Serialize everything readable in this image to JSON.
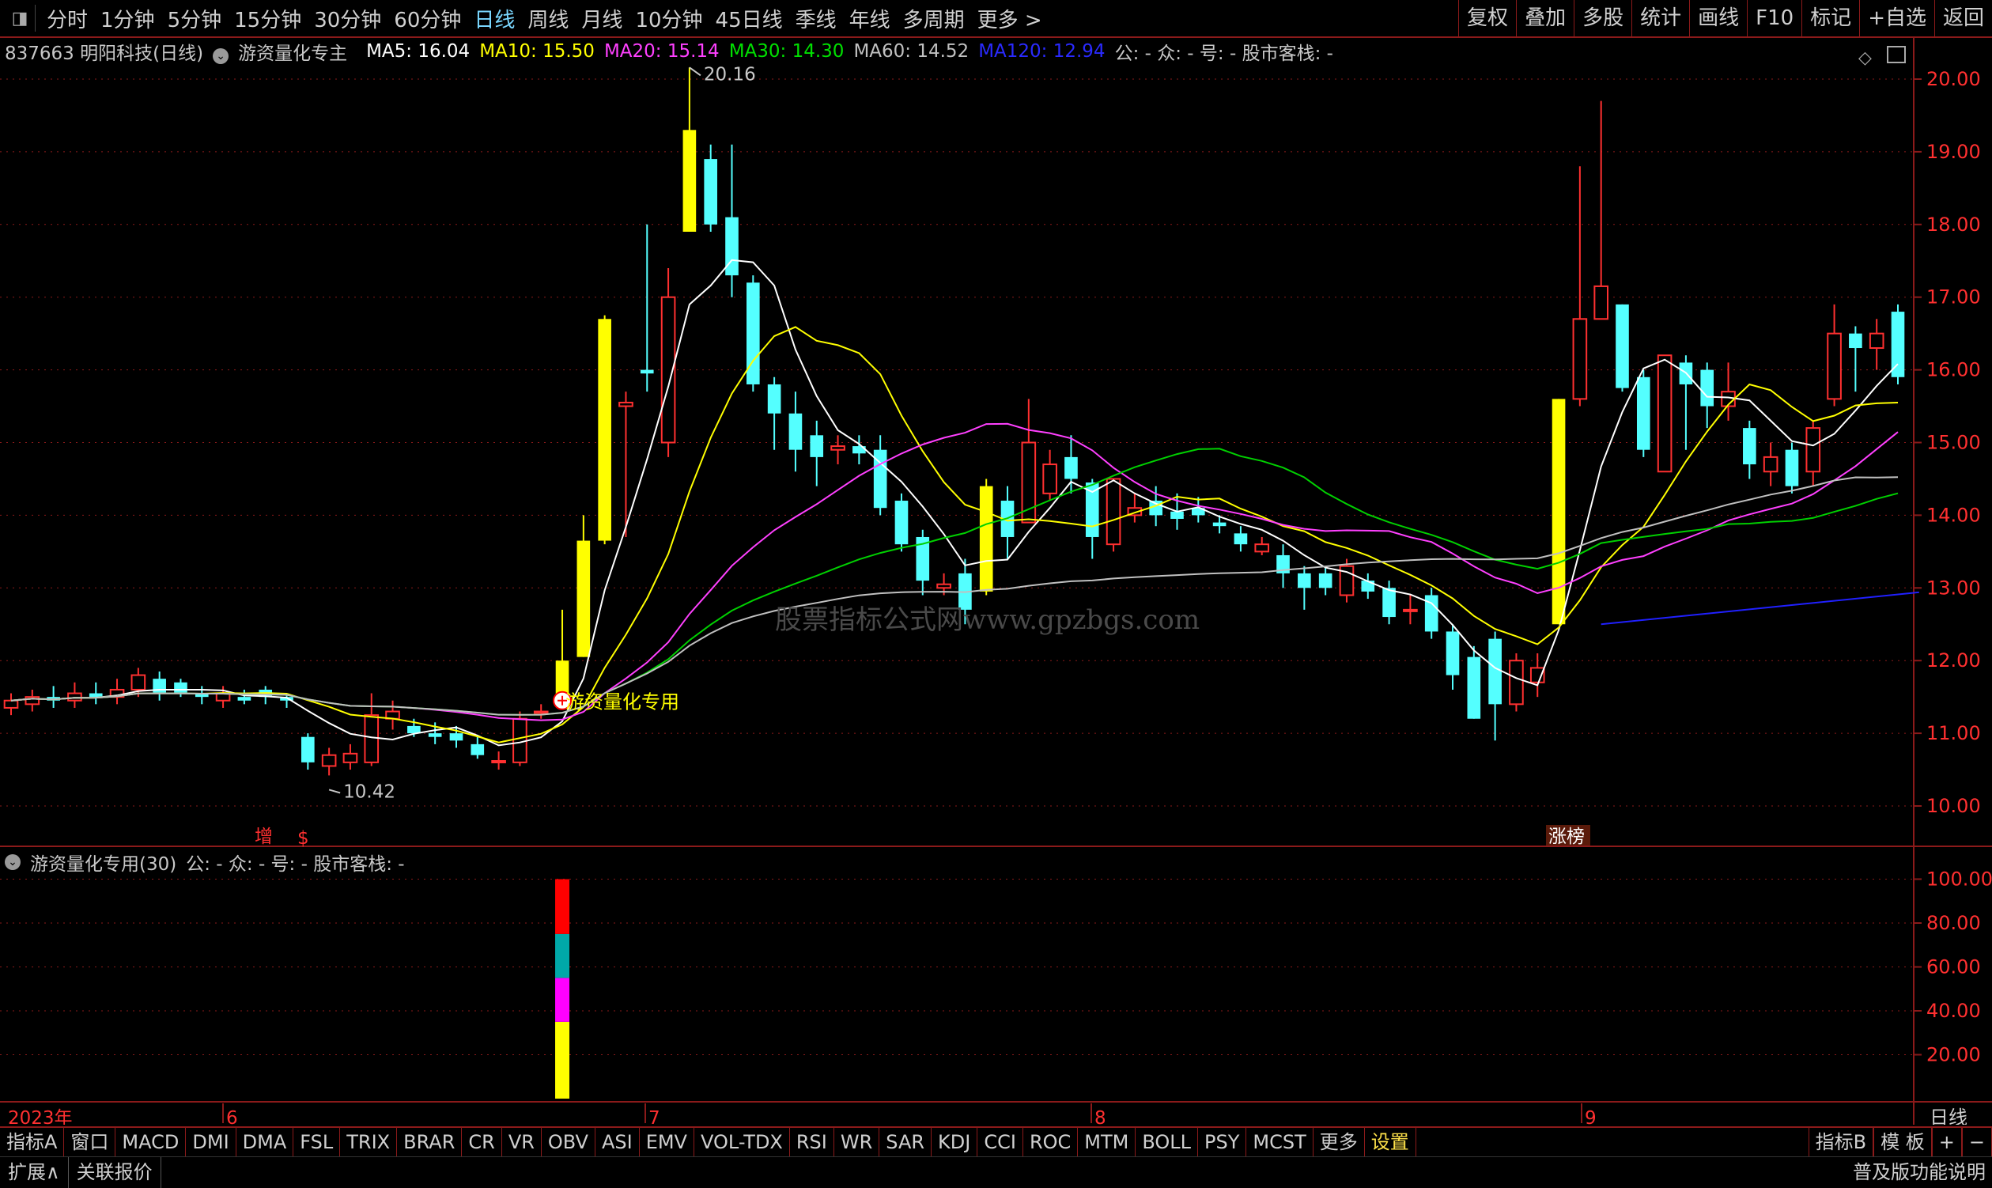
{
  "top_menu": {
    "menu_icon": "window-icon",
    "periods": [
      "分时",
      "1分钟",
      "5分钟",
      "15分钟",
      "30分钟",
      "60分钟",
      "日线",
      "周线",
      "月线",
      "10分钟",
      "45日线",
      "季线",
      "年线",
      "多周期",
      "更多 >"
    ],
    "active_period": "日线",
    "right_buttons": [
      "复权",
      "叠加",
      "多股",
      "统计",
      "画线",
      "F10",
      "标记",
      "+自选",
      "返回"
    ]
  },
  "info": {
    "stock": "837663 明阳科技(日线)",
    "indicator": "游资量化专主",
    "ma5": "MA5: 16.04",
    "ma10": "MA10: 15.50",
    "ma20": "MA20: 15.14",
    "ma30": "MA30: 14.30",
    "ma60": "MA60: 14.52",
    "ma120": "MA120: 12.94",
    "extra": "公: -  众: -  号: -  股市客栈: -"
  },
  "sub": {
    "title": "游资量化专用(30)",
    "extra": "公: -  众: -  号: -  股市客栈: -"
  },
  "labels": {
    "high": "20.16",
    "low": "10.42",
    "signal": "游资量化专用",
    "zeng": "增",
    "dollar": "$",
    "zhangbang": "涨榜",
    "watermark": "股票指标公式网www.gpzbgs.com",
    "year": "2023年",
    "months": [
      "6",
      "7",
      "8",
      "9"
    ],
    "period_label": "日线"
  },
  "colors": {
    "up": "#ff3030",
    "down": "#54ffff",
    "ma5": "#ffffff",
    "ma10": "#ffff00",
    "ma20": "#ff40ff",
    "ma30": "#00d000",
    "ma60": "#c0c0c0",
    "ma120": "#2020ff",
    "grid": "#8b1a1a",
    "signal": "#ffff00"
  },
  "chart_data": {
    "type": "candlestick",
    "yticks": [
      10,
      11,
      12,
      13,
      14,
      15,
      16,
      17,
      18,
      19,
      20
    ],
    "sub_yticks": [
      20,
      40,
      60,
      80,
      100
    ],
    "candles": [
      {
        "o": 11.35,
        "c": 11.45,
        "h": 11.55,
        "l": 11.25
      },
      {
        "o": 11.4,
        "c": 11.5,
        "h": 11.6,
        "l": 11.3
      },
      {
        "o": 11.5,
        "c": 11.45,
        "h": 11.65,
        "l": 11.35
      },
      {
        "o": 11.45,
        "c": 11.55,
        "h": 11.7,
        "l": 11.35
      },
      {
        "o": 11.55,
        "c": 11.5,
        "h": 11.7,
        "l": 11.4
      },
      {
        "o": 11.5,
        "c": 11.6,
        "h": 11.75,
        "l": 11.4
      },
      {
        "o": 11.6,
        "c": 11.8,
        "h": 11.9,
        "l": 11.5
      },
      {
        "o": 11.75,
        "c": 11.55,
        "h": 11.85,
        "l": 11.45
      },
      {
        "o": 11.7,
        "c": 11.55,
        "h": 11.75,
        "l": 11.5
      },
      {
        "o": 11.55,
        "c": 11.5,
        "h": 11.65,
        "l": 11.4
      },
      {
        "o": 11.45,
        "c": 11.55,
        "h": 11.65,
        "l": 11.35
      },
      {
        "o": 11.5,
        "c": 11.45,
        "h": 11.6,
        "l": 11.4
      },
      {
        "o": 11.6,
        "c": 11.5,
        "h": 11.65,
        "l": 11.4
      },
      {
        "o": 11.5,
        "c": 11.45,
        "h": 11.55,
        "l": 11.35
      },
      {
        "o": 10.95,
        "c": 10.6,
        "h": 11.0,
        "l": 10.5
      },
      {
        "o": 10.55,
        "c": 10.7,
        "h": 10.8,
        "l": 10.42
      },
      {
        "o": 10.6,
        "c": 10.72,
        "h": 10.85,
        "l": 10.5
      },
      {
        "o": 10.6,
        "c": 11.25,
        "h": 11.55,
        "l": 10.55
      },
      {
        "o": 11.2,
        "c": 11.3,
        "h": 11.45,
        "l": 11.05
      },
      {
        "o": 11.1,
        "c": 11.0,
        "h": 11.2,
        "l": 10.95
      },
      {
        "o": 11.0,
        "c": 10.95,
        "h": 11.15,
        "l": 10.85
      },
      {
        "o": 11.0,
        "c": 10.9,
        "h": 11.1,
        "l": 10.8
      },
      {
        "o": 10.85,
        "c": 10.7,
        "h": 10.95,
        "l": 10.65
      },
      {
        "o": 10.62,
        "c": 10.62,
        "h": 10.75,
        "l": 10.5
      },
      {
        "o": 10.6,
        "c": 11.2,
        "h": 11.3,
        "l": 10.55
      },
      {
        "o": 11.3,
        "c": 11.3,
        "h": 11.4,
        "l": 11.2
      },
      {
        "o": 11.5,
        "c": 12.0,
        "h": 12.7,
        "l": 11.45,
        "sig": true
      },
      {
        "o": 12.05,
        "c": 13.65,
        "h": 14.0,
        "l": 12.05,
        "sig": true
      },
      {
        "o": 13.65,
        "c": 16.7,
        "h": 16.75,
        "l": 13.6,
        "sig": true
      },
      {
        "o": 15.5,
        "c": 15.55,
        "h": 15.7,
        "l": 13.7
      },
      {
        "o": 16.0,
        "c": 15.95,
        "h": 18.0,
        "l": 15.7
      },
      {
        "o": 15.0,
        "c": 17.0,
        "h": 17.4,
        "l": 14.8
      },
      {
        "o": 17.9,
        "c": 19.3,
        "h": 20.16,
        "l": 17.9,
        "sig": true
      },
      {
        "o": 18.9,
        "c": 18.0,
        "h": 19.1,
        "l": 17.9
      },
      {
        "o": 18.1,
        "c": 17.3,
        "h": 19.1,
        "l": 17.0
      },
      {
        "o": 17.2,
        "c": 15.8,
        "h": 17.3,
        "l": 15.7
      },
      {
        "o": 15.8,
        "c": 15.4,
        "h": 15.9,
        "l": 14.9
      },
      {
        "o": 15.4,
        "c": 14.9,
        "h": 15.7,
        "l": 14.6
      },
      {
        "o": 15.1,
        "c": 14.8,
        "h": 15.3,
        "l": 14.4
      },
      {
        "o": 14.9,
        "c": 14.95,
        "h": 15.1,
        "l": 14.7
      },
      {
        "o": 14.95,
        "c": 14.85,
        "h": 15.1,
        "l": 14.7
      },
      {
        "o": 14.9,
        "c": 14.1,
        "h": 15.1,
        "l": 14.0
      },
      {
        "o": 14.2,
        "c": 13.6,
        "h": 14.3,
        "l": 13.5
      },
      {
        "o": 13.7,
        "c": 13.1,
        "h": 13.8,
        "l": 12.9
      },
      {
        "o": 13.0,
        "c": 13.05,
        "h": 13.2,
        "l": 12.9
      },
      {
        "o": 13.2,
        "c": 12.7,
        "h": 13.4,
        "l": 12.5
      },
      {
        "o": 12.95,
        "c": 14.4,
        "h": 14.5,
        "l": 12.9,
        "sig": true
      },
      {
        "o": 14.2,
        "c": 13.7,
        "h": 14.4,
        "l": 13.4
      },
      {
        "o": 13.9,
        "c": 15.0,
        "h": 15.6,
        "l": 13.9
      },
      {
        "o": 14.3,
        "c": 14.7,
        "h": 14.9,
        "l": 14.2
      },
      {
        "o": 14.8,
        "c": 14.5,
        "h": 15.1,
        "l": 14.3
      },
      {
        "o": 14.45,
        "c": 13.7,
        "h": 14.5,
        "l": 13.4
      },
      {
        "o": 13.6,
        "c": 14.5,
        "h": 14.5,
        "l": 13.5
      },
      {
        "o": 14.0,
        "c": 14.1,
        "h": 14.3,
        "l": 13.9
      },
      {
        "o": 14.2,
        "c": 14.0,
        "h": 14.4,
        "l": 13.85
      },
      {
        "o": 14.05,
        "c": 13.95,
        "h": 14.3,
        "l": 13.8
      },
      {
        "o": 14.1,
        "c": 14.0,
        "h": 14.25,
        "l": 13.9
      },
      {
        "o": 13.9,
        "c": 13.85,
        "h": 14.0,
        "l": 13.75
      },
      {
        "o": 13.75,
        "c": 13.6,
        "h": 13.85,
        "l": 13.5
      },
      {
        "o": 13.5,
        "c": 13.6,
        "h": 13.7,
        "l": 13.45
      },
      {
        "o": 13.45,
        "c": 13.2,
        "h": 13.6,
        "l": 13.0
      },
      {
        "o": 13.2,
        "c": 13.0,
        "h": 13.3,
        "l": 12.7
      },
      {
        "o": 13.2,
        "c": 13.0,
        "h": 13.3,
        "l": 12.9
      },
      {
        "o": 12.9,
        "c": 13.3,
        "h": 13.4,
        "l": 12.8
      },
      {
        "o": 13.1,
        "c": 12.95,
        "h": 13.2,
        "l": 12.85
      },
      {
        "o": 13.0,
        "c": 12.6,
        "h": 13.1,
        "l": 12.5
      },
      {
        "o": 12.7,
        "c": 12.7,
        "h": 12.9,
        "l": 12.5
      },
      {
        "o": 12.9,
        "c": 12.4,
        "h": 13.0,
        "l": 12.3
      },
      {
        "o": 12.4,
        "c": 11.8,
        "h": 12.5,
        "l": 11.6
      },
      {
        "o": 12.05,
        "c": 11.2,
        "h": 12.2,
        "l": 11.2
      },
      {
        "o": 12.3,
        "c": 11.4,
        "h": 12.4,
        "l": 10.9
      },
      {
        "o": 11.4,
        "c": 12.0,
        "h": 12.1,
        "l": 11.3
      },
      {
        "o": 11.7,
        "c": 11.9,
        "h": 12.1,
        "l": 11.5
      },
      {
        "o": 12.5,
        "c": 15.6,
        "h": 15.6,
        "l": 12.5,
        "sig": true
      },
      {
        "o": 15.6,
        "c": 16.7,
        "h": 18.8,
        "l": 15.5
      },
      {
        "o": 16.7,
        "c": 17.15,
        "h": 19.7,
        "l": 16.7
      },
      {
        "o": 16.9,
        "c": 15.75,
        "h": 16.9,
        "l": 15.7
      },
      {
        "o": 15.9,
        "c": 14.9,
        "h": 16.0,
        "l": 14.8
      },
      {
        "o": 14.6,
        "c": 16.2,
        "h": 16.2,
        "l": 14.6
      },
      {
        "o": 16.1,
        "c": 15.8,
        "h": 16.2,
        "l": 14.9
      },
      {
        "o": 16.0,
        "c": 15.5,
        "h": 16.1,
        "l": 15.2
      },
      {
        "o": 15.5,
        "c": 15.7,
        "h": 16.1,
        "l": 15.3
      },
      {
        "o": 15.2,
        "c": 14.7,
        "h": 15.3,
        "l": 14.5
      },
      {
        "o": 14.6,
        "c": 14.8,
        "h": 15.0,
        "l": 14.4
      },
      {
        "o": 14.9,
        "c": 14.4,
        "h": 15.0,
        "l": 14.3
      },
      {
        "o": 14.6,
        "c": 15.2,
        "h": 15.3,
        "l": 14.4
      },
      {
        "o": 15.6,
        "c": 16.5,
        "h": 16.9,
        "l": 15.5
      },
      {
        "o": 16.5,
        "c": 16.3,
        "h": 16.6,
        "l": 15.7
      },
      {
        "o": 16.3,
        "c": 16.5,
        "h": 16.7,
        "l": 16.0
      },
      {
        "o": 16.8,
        "c": 15.9,
        "h": 16.9,
        "l": 15.8
      }
    ],
    "signal_bar": {
      "index": 26,
      "segments": [
        {
          "to": 35,
          "color": "#ffff00"
        },
        {
          "to": 55,
          "color": "#ff00ff"
        },
        {
          "to": 75,
          "color": "#00a8a8"
        },
        {
          "to": 100,
          "color": "#ff0000"
        }
      ]
    },
    "ma120": [
      {
        "i": 75,
        "v": 12.5
      },
      {
        "i": 90,
        "v": 12.94
      }
    ]
  }
}
